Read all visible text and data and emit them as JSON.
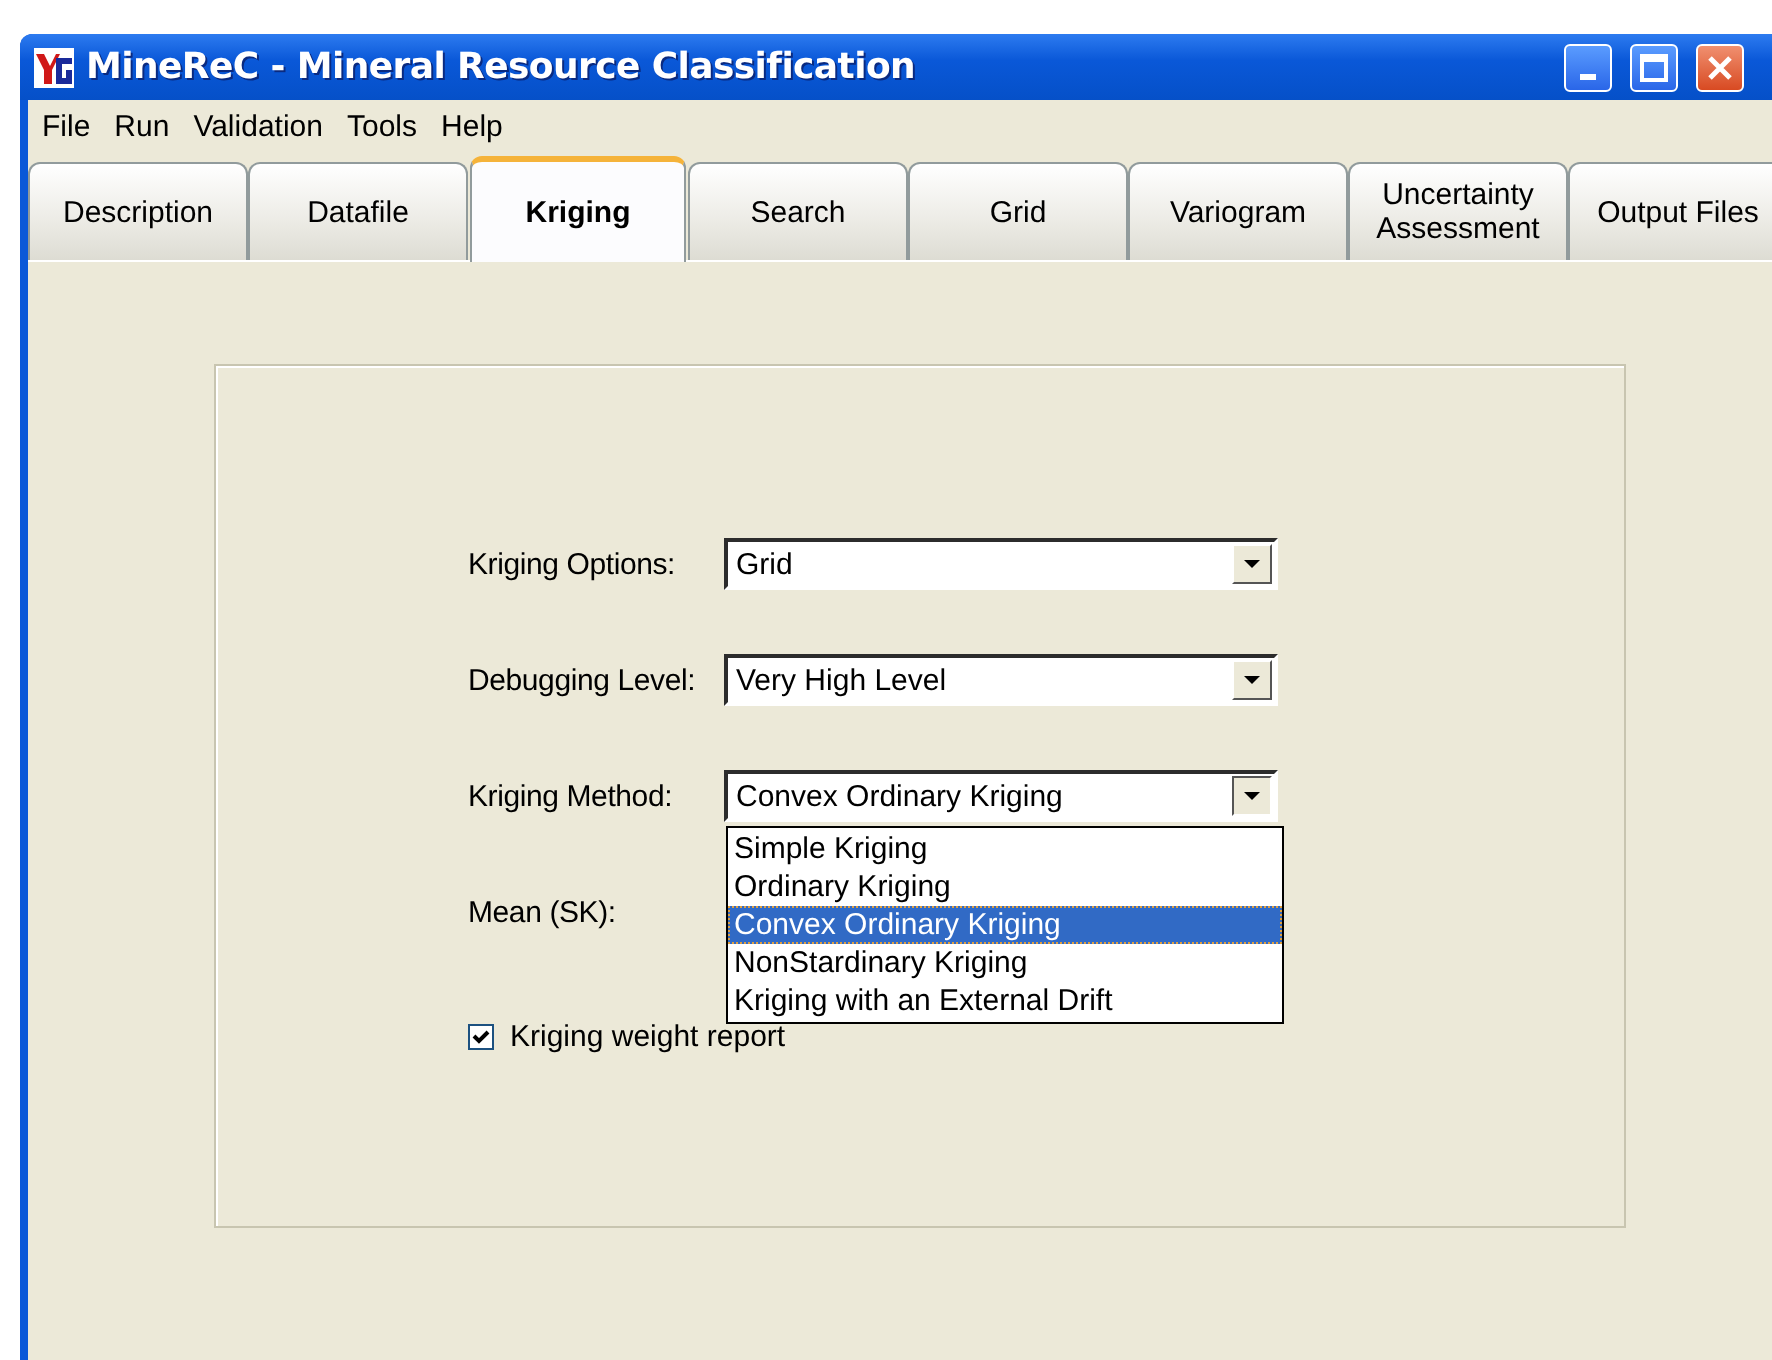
{
  "window": {
    "title": "MineReC - Mineral Resource Classification"
  },
  "menu": [
    "File",
    "Run",
    "Validation",
    "Tools",
    "Help"
  ],
  "tabs": [
    {
      "label": "Description",
      "selected": false
    },
    {
      "label": "Datafile",
      "selected": false
    },
    {
      "label": "Kriging",
      "selected": true
    },
    {
      "label": "Search",
      "selected": false
    },
    {
      "label": "Grid",
      "selected": false
    },
    {
      "label": "Variogram",
      "selected": false
    },
    {
      "label": "Uncertainty Assessment",
      "selected": false
    },
    {
      "label": "Output Files",
      "selected": false
    }
  ],
  "form": {
    "fields": [
      {
        "kind": "combo",
        "label": "Kriging Options:",
        "value": "Grid",
        "expanded": false
      },
      {
        "kind": "combo",
        "label": "Debugging Level:",
        "value": "Very High Level",
        "expanded": false
      },
      {
        "kind": "combo",
        "label": "Kriging Method:",
        "value": "Convex Ordinary Kriging",
        "expanded": true,
        "options": [
          {
            "label": "Simple Kriging",
            "selected": false
          },
          {
            "label": "Ordinary Kriging",
            "selected": false
          },
          {
            "label": "Convex Ordinary Kriging",
            "selected": true
          },
          {
            "label": "NonStardinary Kriging",
            "selected": false
          },
          {
            "label": "Kriging with an External Drift",
            "selected": false
          }
        ]
      },
      {
        "kind": "label",
        "label": "Mean (SK):"
      },
      {
        "kind": "checkbox",
        "label": "Kriging weight report",
        "checked": true
      }
    ]
  }
}
